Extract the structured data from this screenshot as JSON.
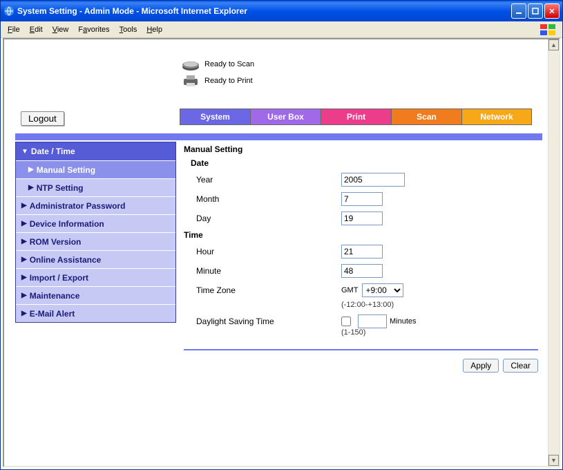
{
  "window": {
    "title": "System Setting - Admin Mode - Microsoft Internet Explorer"
  },
  "menubar": {
    "file": "File",
    "edit": "Edit",
    "view": "View",
    "favorites": "Favorites",
    "tools": "Tools",
    "help": "Help"
  },
  "status": {
    "scan": "Ready to Scan",
    "print": "Ready to Print"
  },
  "logout": "Logout",
  "tabs": {
    "system": "System",
    "userbox": "User Box",
    "print": "Print",
    "scan": "Scan",
    "network": "Network"
  },
  "sidebar": {
    "date_time": "Date / Time",
    "manual_setting": "Manual Setting",
    "ntp_setting": "NTP Setting",
    "admin_password": "Administrator Password",
    "device_info": "Device Information",
    "rom_version": "ROM Version",
    "online_assistance": "Online Assistance",
    "import_export": "Import / Export",
    "maintenance": "Maintenance",
    "email_alert": "E-Mail Alert"
  },
  "panel": {
    "title": "Manual Setting",
    "date_label": "Date",
    "year_label": "Year",
    "year_value": "2005",
    "month_label": "Month",
    "month_value": "7",
    "day_label": "Day",
    "day_value": "19",
    "time_label": "Time",
    "hour_label": "Hour",
    "hour_value": "21",
    "minute_label": "Minute",
    "minute_value": "48",
    "tz_label": "Time Zone",
    "tz_gmt": "GMT",
    "tz_value": "+9:00",
    "tz_hint": "(-12:00-+13:00)",
    "dst_label": "Daylight Saving Time",
    "dst_minutes": "Minutes",
    "dst_hint": "(1-150)",
    "apply": "Apply",
    "clear": "Clear"
  }
}
